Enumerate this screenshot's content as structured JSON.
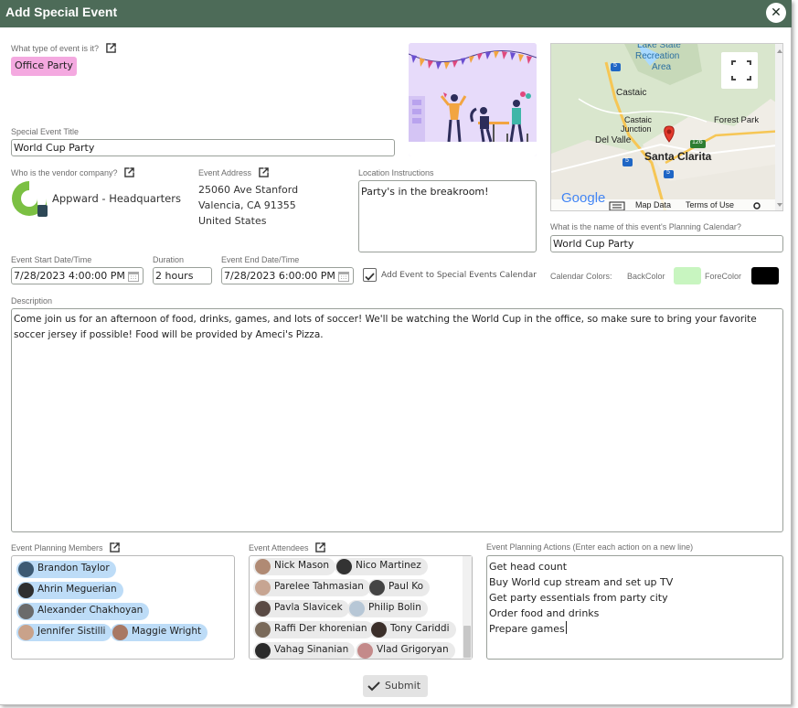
{
  "dialog": {
    "title": "Add Special Event",
    "close_label": "✕"
  },
  "event_type": {
    "label": "What type of event is it?",
    "value": "Office Party"
  },
  "title_field": {
    "label": "Special Event Title",
    "value": "World Cup Party"
  },
  "vendor": {
    "label": "Who is the vendor company?",
    "name": "Appward - Headquarters"
  },
  "address": {
    "label": "Event Address",
    "line1": "25060 Ave Stanford",
    "line2": "Valencia, CA 91355",
    "line3": "United States"
  },
  "location": {
    "label": "Location Instructions",
    "value": "Party's in the breakroom!"
  },
  "map": {
    "labels": {
      "lake": "Lake State",
      "recreation": "Recreation",
      "area": "Area",
      "castaic": "Castaic",
      "junction1": "Castaic",
      "junction2": "Junction",
      "forest_park": "Forest Park",
      "del_valle": "Del Valle",
      "santa_clarita": "Santa Clarita"
    },
    "shields": {
      "i5a": "5",
      "i5b": "5",
      "r126": "126",
      "i5c": "5"
    },
    "google": "Google",
    "map_data": "Map Data",
    "terms": "Terms of Use"
  },
  "calendar": {
    "label": "What is the name of this event's Planning Calendar?",
    "value": "World Cup Party"
  },
  "start": {
    "label": "Event Start Date/Time",
    "value": "7/28/2023 4:00:00 PM"
  },
  "duration": {
    "label": "Duration",
    "value": "2 hours"
  },
  "end": {
    "label": "Event End Date/Time",
    "value": "7/28/2023 6:00:00 PM"
  },
  "add_to_calendar": {
    "label": "Add Event to Special Events Calendar",
    "checked": true
  },
  "calendar_colors": {
    "label": "Calendar Colors:",
    "back_label": "BackColor",
    "back_color": "#c8f5c0",
    "fore_label": "ForeColor",
    "fore_color": "#000000"
  },
  "description": {
    "label": "Description",
    "line1": "Come join us for an afternoon of food, drinks, games, and lots of soccer! We'll be watching the World Cup in the office, so make sure to bring your favorite",
    "line2": "soccer jersey if possible! Food will be provided by Ameci's Pizza."
  },
  "members": {
    "label": "Event Planning Members",
    "items": [
      "Brandon Taylor",
      "Ahrin Meguerian",
      "Alexander Chakhoyan",
      "Jennifer Sistilli",
      "Maggie Wright"
    ]
  },
  "attendees": {
    "label": "Event Attendees",
    "items": [
      "Nick Mason",
      "Nico Martinez",
      "Parelee Tahmasian",
      "Paul Ko",
      "Pavla Slavicek",
      "Philip Bolin",
      "Raffi Der khorenian",
      "Tony Cariddi",
      "Vahag Sinanian",
      "Vlad Grigoryan"
    ]
  },
  "actions": {
    "label": "Event Planning Actions (Enter each action on a new line)",
    "items": [
      "Get head count",
      "Buy World cup stream and set up TV",
      "Get party essentials from party city",
      "Order food and drinks",
      "Prepare games"
    ]
  },
  "submit": {
    "label": "Submit"
  },
  "colors": {
    "titlebar": "#4d6b58",
    "tag": "#f4a9e0",
    "chip_member": "#bddcf7",
    "chip_attendee": "#eaeaea",
    "vendor_green": "#7bc043"
  }
}
